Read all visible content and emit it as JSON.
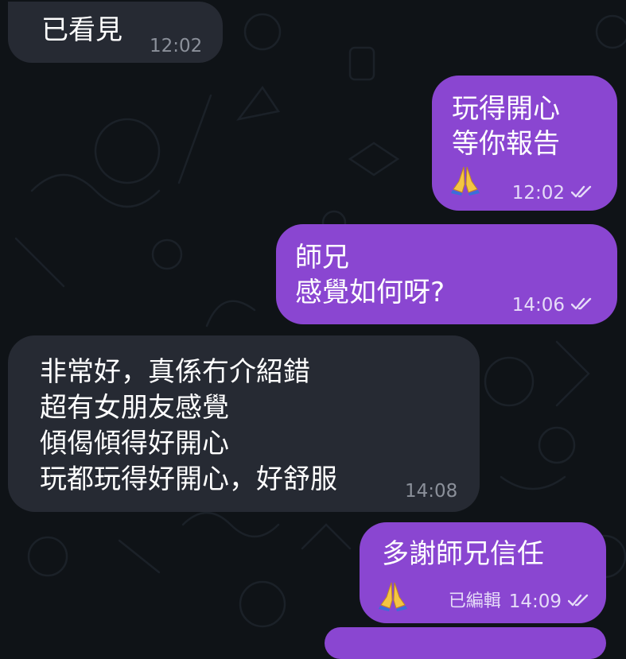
{
  "messages": [
    {
      "id": "m1",
      "direction": "incoming",
      "lines": [
        "已看見"
      ],
      "time": "12:02"
    },
    {
      "id": "m2",
      "direction": "outgoing",
      "lines": [
        "玩得開心",
        "等你報告"
      ],
      "emoji": "praying-hands-icon",
      "time": "12:02",
      "status": "read"
    },
    {
      "id": "m3",
      "direction": "outgoing",
      "lines": [
        "師兄",
        "感覺如何呀?"
      ],
      "time": "14:06",
      "status": "read"
    },
    {
      "id": "m4",
      "direction": "incoming",
      "lines": [
        "非常好，真係冇介紹錯",
        "超有女朋友感覺",
        "傾偈傾得好開心",
        "玩都玩得好開心，好舒服"
      ],
      "time": "14:08"
    },
    {
      "id": "m5",
      "direction": "outgoing",
      "lines": [
        "多謝師兄信任"
      ],
      "emoji": "praying-hands-icon",
      "edited_label": "已編輯",
      "time": "14:09",
      "status": "read"
    }
  ],
  "colors": {
    "background": "#0f1317",
    "incoming_bubble": "#262a33",
    "outgoing_bubble": "#8a46d1"
  }
}
